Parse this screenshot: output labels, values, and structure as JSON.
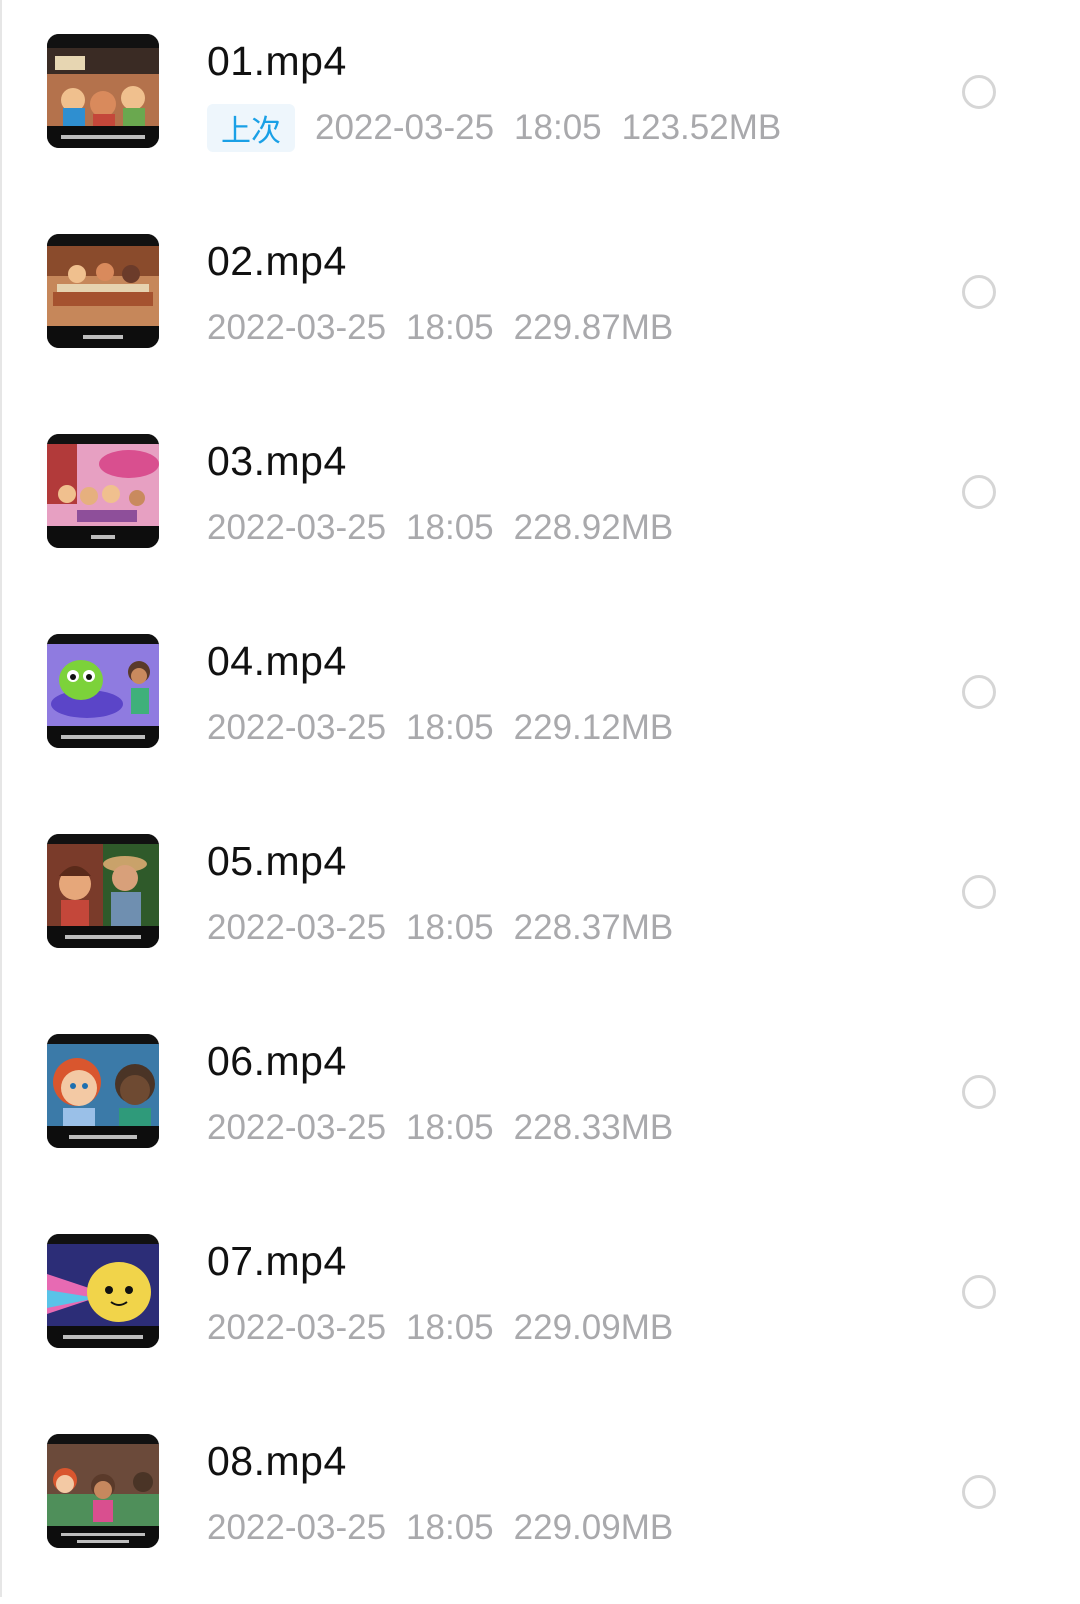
{
  "files": [
    {
      "name": "01.mp4",
      "badge": "上次",
      "date": "2022-03-25",
      "time": "18:05",
      "size": "123.52MB",
      "thumb": {
        "top": "#3a2b24",
        "main": "#b4724c",
        "accent": "#2f8fd0",
        "bottom": "#0d0d0d"
      }
    },
    {
      "name": "02.mp4",
      "badge": "",
      "date": "2022-03-25",
      "time": "18:05",
      "size": "229.87MB",
      "thumb": {
        "top": "#8a4b2c",
        "main": "#c6875a",
        "accent": "#e6d3b0",
        "bottom": "#0d0d0d"
      }
    },
    {
      "name": "03.mp4",
      "badge": "",
      "date": "2022-03-25",
      "time": "18:05",
      "size": "228.92MB",
      "thumb": {
        "top": "#b23a3a",
        "main": "#e7a0c2",
        "accent": "#8e4f9a",
        "bottom": "#0d0d0d"
      }
    },
    {
      "name": "04.mp4",
      "badge": "",
      "date": "2022-03-25",
      "time": "18:05",
      "size": "229.12MB",
      "thumb": {
        "top": "#5b45c8",
        "main": "#8f7be0",
        "accent": "#7cd23a",
        "bottom": "#0d0d0d"
      }
    },
    {
      "name": "05.mp4",
      "badge": "",
      "date": "2022-03-25",
      "time": "18:05",
      "size": "228.37MB",
      "thumb": {
        "top": "#2f5a2a",
        "main": "#8a5a3c",
        "accent": "#c4473a",
        "bottom": "#0d0d0d"
      }
    },
    {
      "name": "06.mp4",
      "badge": "",
      "date": "2022-03-25",
      "time": "18:05",
      "size": "228.33MB",
      "thumb": {
        "top": "#3b7aa8",
        "main": "#e9865a",
        "accent": "#4a3426",
        "bottom": "#0d0d0d"
      }
    },
    {
      "name": "07.mp4",
      "badge": "",
      "date": "2022-03-25",
      "time": "18:05",
      "size": "229.09MB",
      "thumb": {
        "top": "#2c2d77",
        "main": "#f1d44a",
        "accent": "#e76ab3",
        "bottom": "#0d0d0d"
      }
    },
    {
      "name": "08.mp4",
      "badge": "",
      "date": "2022-03-25",
      "time": "18:05",
      "size": "229.09MB",
      "thumb": {
        "top": "#6b4a3a",
        "main": "#4f8f5a",
        "accent": "#c6885e",
        "bottom": "#0d0d0d"
      }
    }
  ]
}
